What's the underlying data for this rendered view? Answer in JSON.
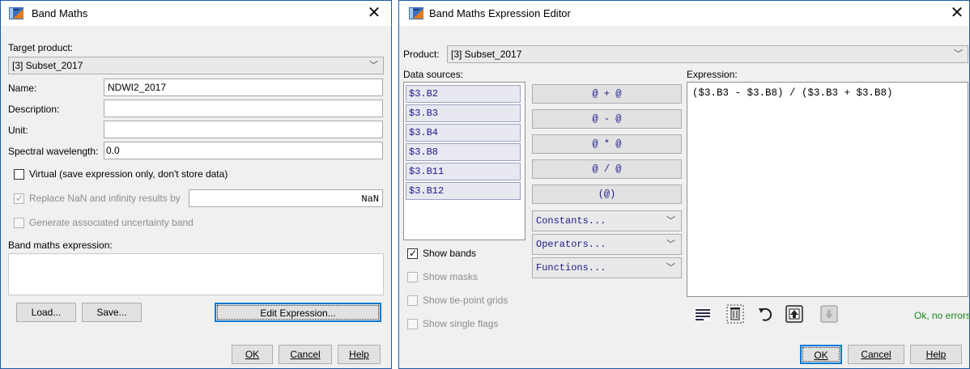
{
  "band_maths": {
    "title": "Band Maths",
    "target_product_label": "Target product:",
    "target_product_value": "[3] Subset_2017",
    "name_label": "Name:",
    "name_value": "NDWI2_2017",
    "description_label": "Description:",
    "description_value": "",
    "unit_label": "Unit:",
    "unit_value": "",
    "wavelength_label": "Spectral wavelength:",
    "wavelength_value": "0.0",
    "virtual_label": "Virtual (save expression only, don't store data)",
    "virtual_checked": false,
    "replace_nan_label": "Replace NaN and infinity results by",
    "replace_nan_checked": true,
    "replace_nan_value": "NaN",
    "uncertainty_label": "Generate associated uncertainty band",
    "uncertainty_checked": false,
    "expression_label": "Band maths expression:",
    "expression_value": "",
    "load_button": "Load...",
    "save_button": "Save...",
    "edit_expression_button": "Edit Expression...",
    "ok_button": "OK",
    "cancel_button": "Cancel",
    "help_button": "Help"
  },
  "editor": {
    "title": "Band Maths Expression Editor",
    "product_label": "Product:",
    "product_value": "[3] Subset_2017",
    "data_sources_label": "Data sources:",
    "data_sources": [
      "$3.B2",
      "$3.B3",
      "$3.B4",
      "$3.B8",
      "$3.B11",
      "$3.B12"
    ],
    "operators": [
      "@ + @",
      "@ - @",
      "@ * @",
      "@ / @",
      "(@)"
    ],
    "constants_label": "Constants...",
    "operators_label": "Operators...",
    "functions_label": "Functions...",
    "show_bands_label": "Show bands",
    "show_bands_checked": true,
    "show_masks_label": "Show masks",
    "show_tiepoint_label": "Show tie-point grids",
    "show_flags_label": "Show single flags",
    "expression_label": "Expression:",
    "expression_value": "($3.B3 - $3.B8) / ($3.B3 + $3.B8)",
    "status": "Ok, no errors.",
    "ok_button": "OK",
    "cancel_button": "Cancel",
    "help_button": "Help"
  },
  "icons": {
    "app": "snap-band-maths-icon",
    "close": "close-icon",
    "chevron": "chevron-down-icon",
    "tools": [
      "expression-history-icon",
      "clear-expression-icon",
      "undo-icon",
      "import-expression-icon",
      "export-expression-icon"
    ]
  },
  "colors": {
    "window_border": "#1f5aa6",
    "window_bg": "#f0f0f0",
    "source_text": "#1a1a8c",
    "status_ok": "#1c8a1c",
    "focus_blue": "#0078d7"
  }
}
